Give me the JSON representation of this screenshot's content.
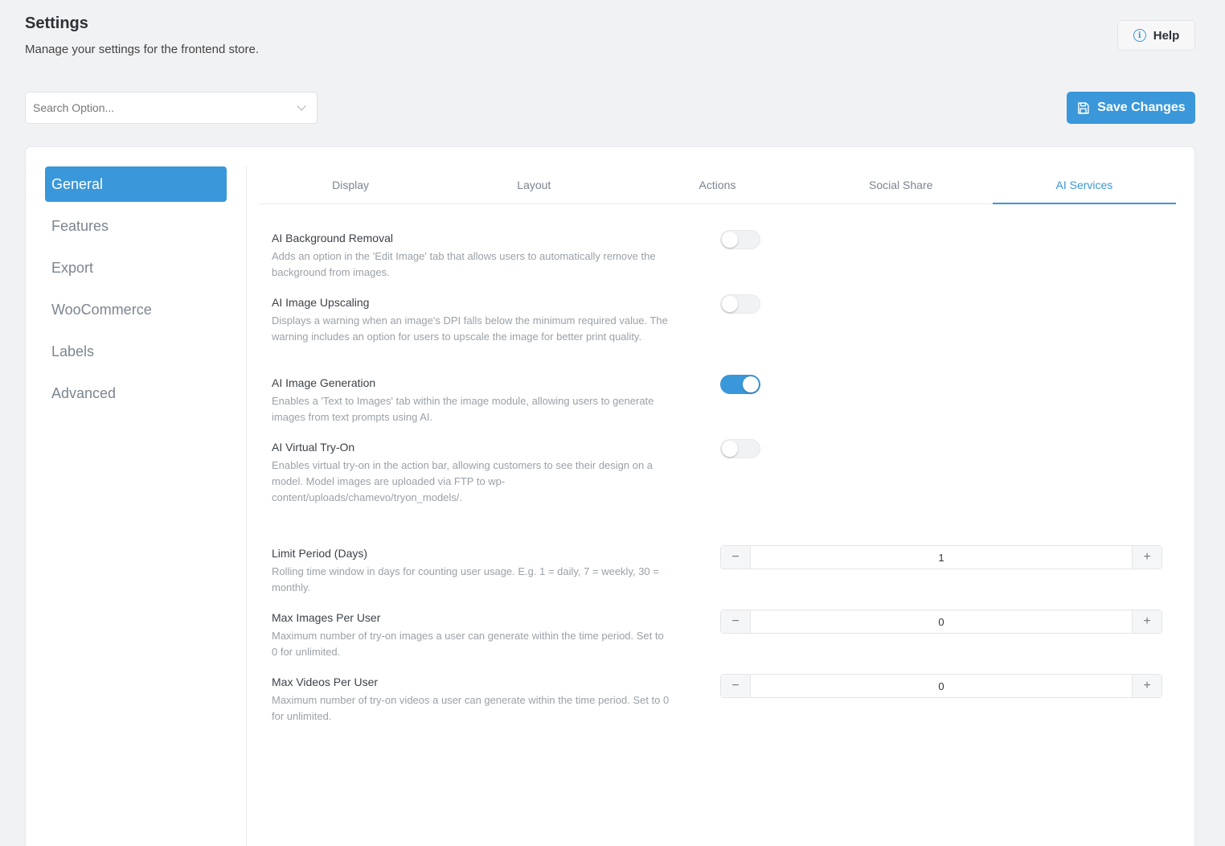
{
  "header": {
    "title": "Settings",
    "subtitle": "Manage your settings for the frontend store.",
    "help_label": "Help"
  },
  "search": {
    "placeholder": "Search Option..."
  },
  "toolbar": {
    "save_label": "Save Changes"
  },
  "sidebar": {
    "items": [
      {
        "label": "General",
        "active": true
      },
      {
        "label": "Features"
      },
      {
        "label": "Export"
      },
      {
        "label": "WooCommerce"
      },
      {
        "label": "Labels"
      },
      {
        "label": "Advanced"
      }
    ]
  },
  "tabs": [
    {
      "label": "Display"
    },
    {
      "label": "Layout"
    },
    {
      "label": "Actions"
    },
    {
      "label": "Social Share"
    },
    {
      "label": "AI Services",
      "active": true
    }
  ],
  "settings": {
    "bg_removal": {
      "label": "AI Background Removal",
      "desc": "Adds an option in the 'Edit Image' tab that allows users to automatically remove the background from images.",
      "enabled": false
    },
    "upscaling": {
      "label": "AI Image Upscaling",
      "desc": "Displays a warning when an image's DPI falls below the minimum required value. The warning includes an option for users to upscale the image for better print quality.",
      "enabled": false
    },
    "generation": {
      "label": "AI Image Generation",
      "desc": "Enables a 'Text to Images' tab within the image module, allowing users to generate images from text prompts using AI.",
      "enabled": true
    },
    "tryon": {
      "label": "AI Virtual Try-On",
      "desc": "Enables virtual try-on in the action bar, allowing customers to see their design on a model. Model images are uploaded via FTP to wp-content/uploads/chamevo/tryon_models/.",
      "enabled": false
    },
    "limit_period": {
      "label": "Limit Period (Days)",
      "desc": "Rolling time window in days for counting user usage. E.g. 1 = daily, 7 = weekly, 30 = monthly.",
      "value": "1"
    },
    "max_images": {
      "label": "Max Images Per User",
      "desc": "Maximum number of try-on images a user can generate within the time period. Set to 0 for unlimited.",
      "value": "0"
    },
    "max_videos": {
      "label": "Max Videos Per User",
      "desc": "Maximum number of try-on videos a user can generate within the time period. Set to 0 for unlimited.",
      "value": "0"
    }
  },
  "stepper_symbols": {
    "minus": "−",
    "plus": "+"
  },
  "colors": {
    "accent": "#3a97d9",
    "background": "#f1f2f4"
  }
}
